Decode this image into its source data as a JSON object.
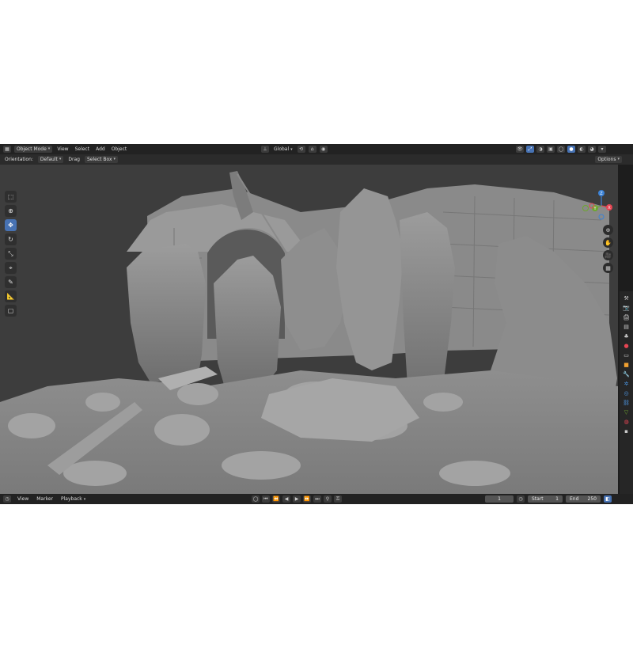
{
  "header": {
    "mode": "Object Mode",
    "menus": [
      "View",
      "Select",
      "Add",
      "Object"
    ],
    "transform_orientation": "Global",
    "right_button_label": "Options"
  },
  "tool_settings": {
    "orientation_label": "Orientation:",
    "orientation_value": "Default",
    "drag_label": "Drag",
    "drag_value": "Select Box"
  },
  "toolbar_tools": [
    "select-box",
    "cursor",
    "move",
    "rotate",
    "scale",
    "transform",
    "annotate",
    "measure",
    "add-cube"
  ],
  "gizmo_axes": {
    "x": "X",
    "y": "Y",
    "z": "Z"
  },
  "timeline": {
    "menus": [
      "View",
      "Marker",
      "Playback"
    ],
    "current_frame": "1",
    "start_label": "Start",
    "start_value": "1",
    "end_label": "End",
    "end_value": "250"
  },
  "colors": {
    "accent": "#4772b3",
    "axis_x": "#e64553",
    "axis_y": "#6ea62f",
    "axis_z": "#3b82d6",
    "viewport": "#3d3d3d"
  }
}
